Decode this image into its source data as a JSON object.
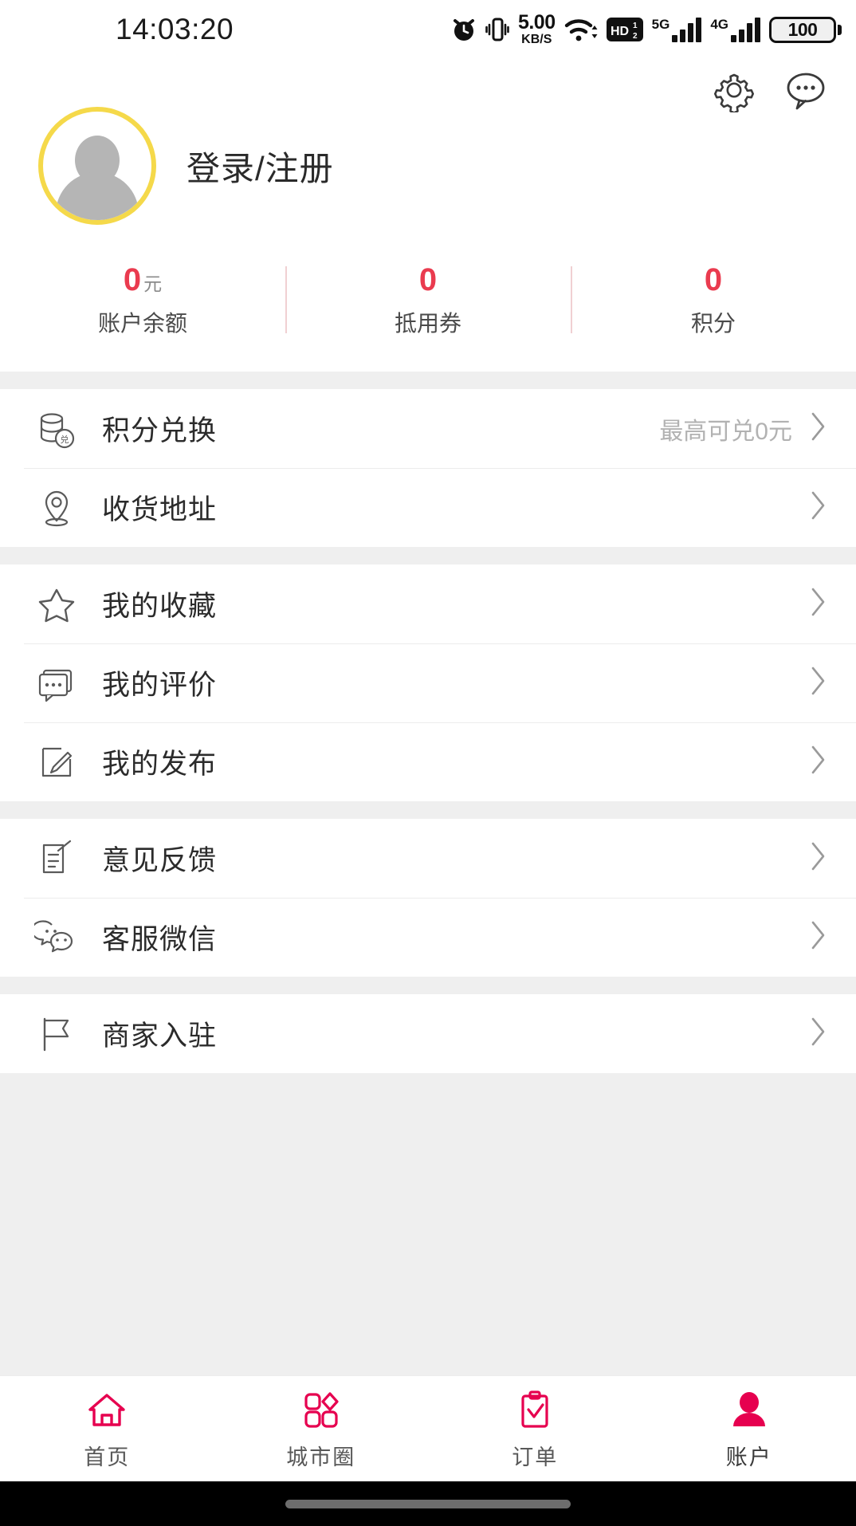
{
  "status_bar": {
    "time": "14:03:20",
    "net_speed_value": "5.00",
    "net_speed_unit": "KB/S",
    "hd_label": "HD",
    "sim1_network": "5G",
    "sim2_network": "4G",
    "battery_percent": "100",
    "icons": [
      "alarm-clock-icon",
      "vibrate-icon",
      "network-speed-icon",
      "wifi-icon",
      "hd-volte-icon",
      "signal-5g-icon",
      "signal-4g-icon",
      "battery-icon"
    ]
  },
  "header": {
    "settings_icon": "gear-icon",
    "message_icon": "chat-bubble-icon",
    "login_text": "登录/注册",
    "avatar_icon": "user-avatar-placeholder",
    "avatar_ring_color": "#f5d94a"
  },
  "stats": [
    {
      "value": "0",
      "unit": "元",
      "label": "账户余额"
    },
    {
      "value": "0",
      "unit": "",
      "label": "抵用券"
    },
    {
      "value": "0",
      "unit": "",
      "label": "积分"
    }
  ],
  "accent_colors": {
    "stat_value": "#ea3b4f",
    "tab_active": "#e6004f",
    "avatar_ring": "#f5d94a"
  },
  "menu_groups": [
    {
      "rows": [
        {
          "label": "积分兑换",
          "icon": "coin-stack-exchange-icon",
          "note": "最高可兑0元",
          "chevron": "chevron-right-icon"
        },
        {
          "label": "收货地址",
          "icon": "location-pin-icon",
          "note": "",
          "chevron": "chevron-right-icon"
        }
      ]
    },
    {
      "rows": [
        {
          "label": "我的收藏",
          "icon": "star-icon",
          "note": "",
          "chevron": "chevron-right-icon"
        },
        {
          "label": "我的评价",
          "icon": "comment-icon",
          "note": "",
          "chevron": "chevron-right-icon"
        },
        {
          "label": "我的发布",
          "icon": "edit-pencil-icon",
          "note": "",
          "chevron": "chevron-right-icon"
        }
      ]
    },
    {
      "rows": [
        {
          "label": "意见反馈",
          "icon": "feedback-note-icon",
          "note": "",
          "chevron": "chevron-right-icon"
        },
        {
          "label": "客服微信",
          "icon": "wechat-icon",
          "note": "",
          "chevron": "chevron-right-icon"
        }
      ]
    },
    {
      "rows": [
        {
          "label": "商家入驻",
          "icon": "flag-icon",
          "note": "",
          "chevron": "chevron-right-icon"
        }
      ]
    }
  ],
  "tabbar": [
    {
      "label": "首页",
      "icon": "home-icon",
      "active": false
    },
    {
      "label": "城市圈",
      "icon": "city-circle-icon",
      "active": false
    },
    {
      "label": "订单",
      "icon": "clipboard-check-icon",
      "active": false
    },
    {
      "label": "账户",
      "icon": "user-filled-icon",
      "active": true
    }
  ]
}
